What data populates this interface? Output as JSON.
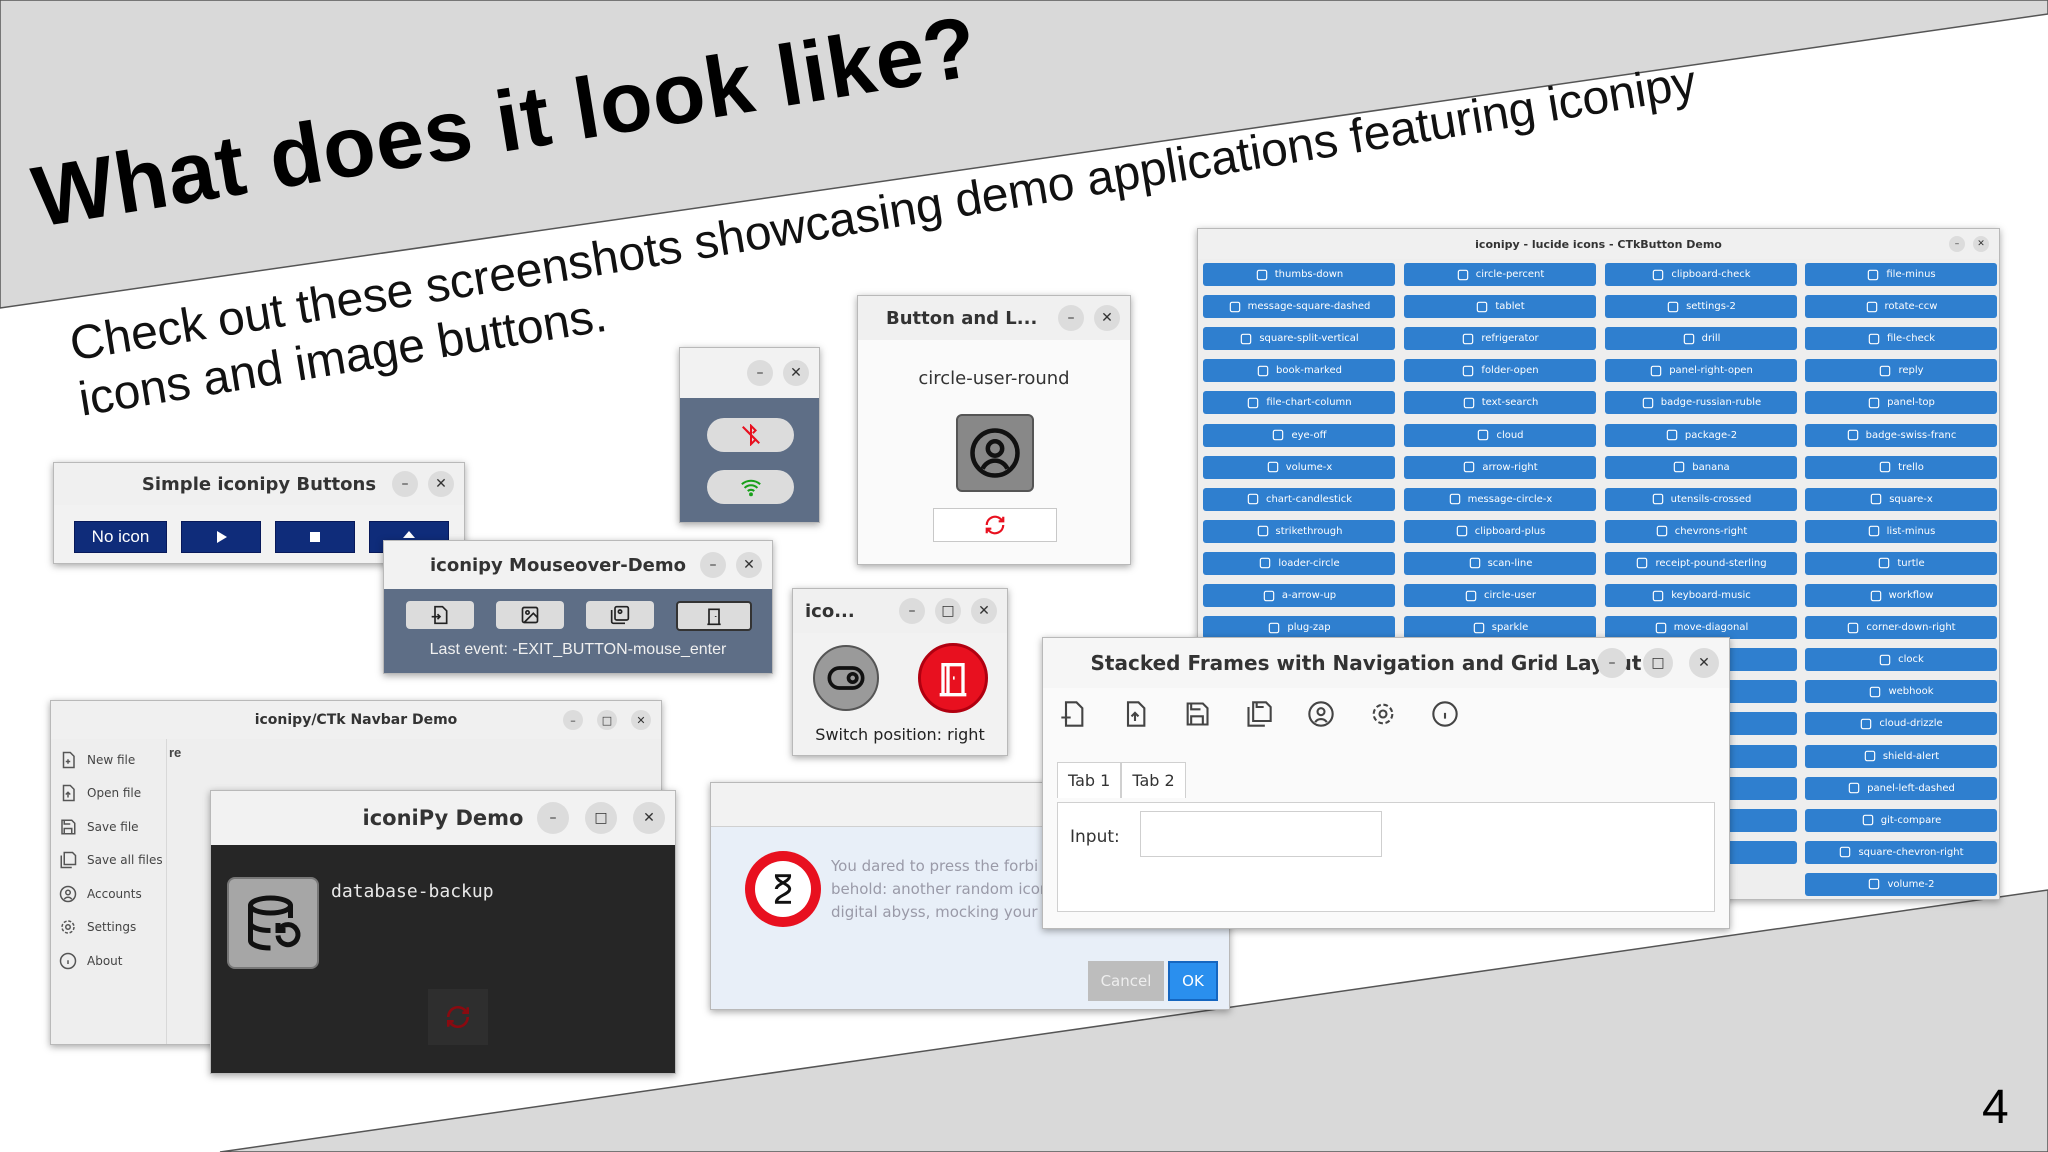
{
  "slide": {
    "title": "What does it look like?",
    "subtitle_line1": "Check out these screenshots showcasing demo applications featuring iconipy",
    "subtitle_line2": "icons and image buttons.",
    "page_number": "4"
  },
  "simple_buttons": {
    "title": "Simple iconipy Buttons",
    "no_icon_label": "No icon",
    "icons": [
      "play-icon",
      "stop-icon",
      "eject-icon"
    ]
  },
  "toggle_small": {
    "icons": [
      "bluetooth-off-icon",
      "wifi-icon"
    ]
  },
  "button_label": {
    "title": "Button and L...",
    "label": "circle-user-round",
    "icons": [
      "circle-user-round-icon",
      "refresh-icon"
    ]
  },
  "mouseover": {
    "title": "iconipy Mouseover-Demo",
    "title_visible": "iconipy Mouseover-Demo",
    "last_event": "Last event: -EXIT_BUTTON-mouse_enter",
    "icons": [
      "file-input-icon",
      "image-icon",
      "images-icon",
      "door-icon"
    ]
  },
  "switch_win": {
    "title": "ico...",
    "status": "Switch position: right",
    "icons": [
      "toggle-right-icon",
      "door-open-icon"
    ]
  },
  "navbar": {
    "title": "iconipy/CTk Navbar Demo",
    "items": [
      {
        "label": "New file"
      },
      {
        "label": "Open file"
      },
      {
        "label": "Save file"
      },
      {
        "label": "Save all files"
      },
      {
        "label": "Accounts"
      },
      {
        "label": "Settings"
      },
      {
        "label": "About"
      }
    ],
    "content_fragment": "re"
  },
  "iconipy_demo": {
    "title": "iconiPy Demo",
    "label": "database-backup"
  },
  "dialog": {
    "message_line1": "You dared to press the forbi",
    "message_line2": "behold: another random icon",
    "message_line3": "digital abyss, mocking your c",
    "cancel": "Cancel",
    "ok": "OK"
  },
  "stacked": {
    "title": "Stacked Frames with Navigation and Grid Layout",
    "tabs": [
      "Tab 1",
      "Tab 2"
    ],
    "input_label": "Input:",
    "input_value": "",
    "toolbar_icons": [
      "file-plus-icon",
      "file-up-icon",
      "save-icon",
      "save-all-icon",
      "circle-user-icon",
      "settings-icon",
      "info-icon"
    ]
  },
  "lucide": {
    "title": "iconipy - lucide icons - CTkButton Demo",
    "columns": [
      [
        "thumbs-down",
        "message-square-dashed",
        "square-split-vertical",
        "book-marked",
        "file-chart-column",
        "eye-off",
        "volume-x",
        "chart-candlestick",
        "strikethrough",
        "loader-circle",
        "a-arrow-up",
        "plug-zap"
      ],
      [
        "circle-percent",
        "tablet",
        "refrigerator",
        "folder-open",
        "text-search",
        "cloud",
        "arrow-right",
        "message-circle-x",
        "clipboard-plus",
        "scan-line",
        "circle-user",
        "sparkle"
      ],
      [
        "clipboard-check",
        "settings-2",
        "drill",
        "panel-right-open",
        "badge-russian-ruble",
        "package-2",
        "banana",
        "utensils-crossed",
        "chevrons-right",
        "receipt-pound-sterling",
        "keyboard-music",
        "move-diagonal"
      ],
      [
        "file-minus",
        "rotate-ccw",
        "file-check",
        "reply",
        "panel-top",
        "badge-swiss-franc",
        "trello",
        "square-x",
        "list-minus",
        "turtle",
        "workflow",
        "corner-down-right",
        "clock",
        "webhook",
        "cloud-drizzle",
        "shield-alert",
        "panel-left-dashed",
        "git-compare",
        "square-chevron-right",
        "volume-2"
      ]
    ],
    "partial_col3": [
      "eso",
      "n",
      "t",
      "erge",
      "",
      "",
      "r"
    ]
  },
  "colors": {
    "slide_band": "#d9d9d9",
    "dark_button": "#0f2c7a",
    "ctk_blue": "#2f7fcf",
    "danger_red": "#e8101f",
    "ok_blue": "#2a8fee"
  }
}
